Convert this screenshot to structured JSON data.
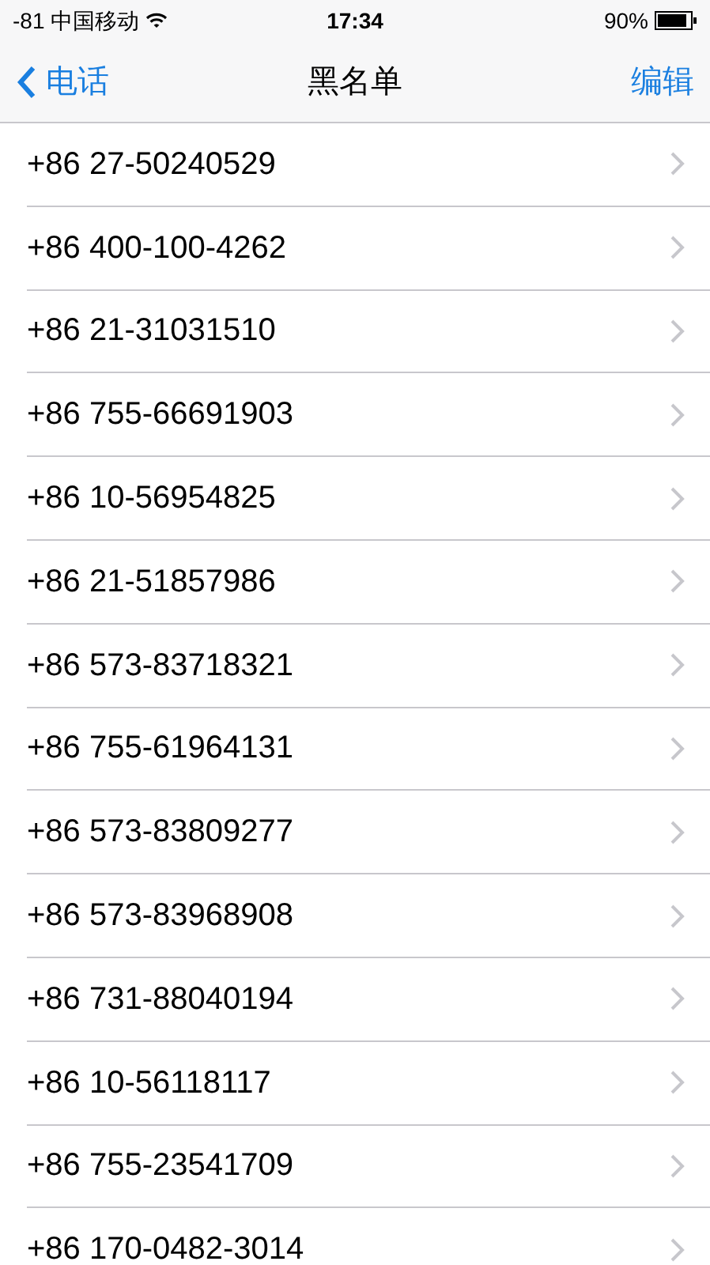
{
  "status_bar": {
    "signal": "-81",
    "carrier": "中国移动",
    "time": "17:34",
    "battery": "90%"
  },
  "nav_bar": {
    "back": "电话",
    "title": "黑名单",
    "action": "编辑"
  },
  "rows": [
    {
      "number": "+86 27-50240529"
    },
    {
      "number": "+86 400-100-4262"
    },
    {
      "number": "+86 21-31031510"
    },
    {
      "number": "+86 755-66691903"
    },
    {
      "number": "+86 10-56954825"
    },
    {
      "number": "+86 21-51857986"
    },
    {
      "number": "+86 573-83718321"
    },
    {
      "number": "+86 755-61964131"
    },
    {
      "number": "+86 573-83809277"
    },
    {
      "number": "+86 573-83968908"
    },
    {
      "number": "+86 731-88040194"
    },
    {
      "number": "+86 10-56118117"
    },
    {
      "number": "+86 755-23541709"
    },
    {
      "number": "+86 170-0482-3014"
    }
  ]
}
